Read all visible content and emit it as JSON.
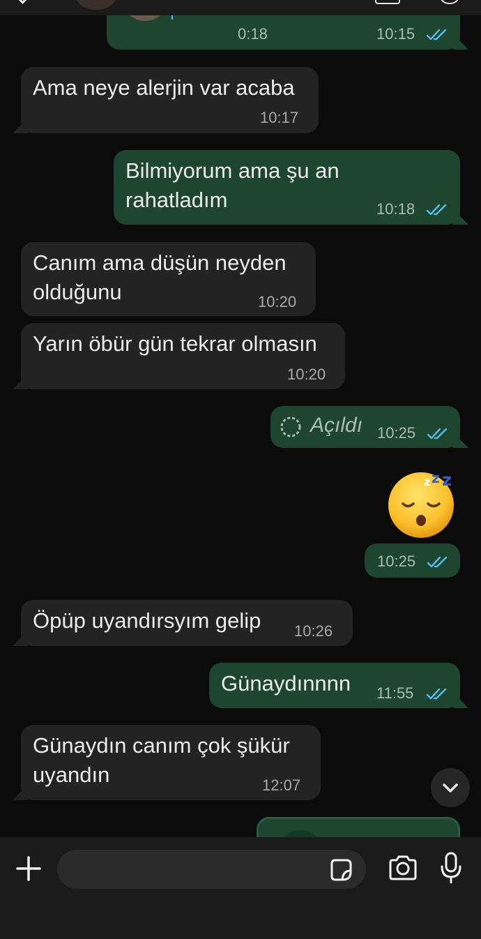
{
  "voice_message": {
    "duration": "0:18",
    "time": "10:15"
  },
  "messages": [
    {
      "text": "Ama neye alerjin var acaba",
      "time": "10:17"
    },
    {
      "text": "Bilmiyorum ama şu an\nrahatladım",
      "time": "10:18"
    },
    {
      "text": "Canım ama düşün neyden\nolduğunu",
      "time": "10:20"
    },
    {
      "text": "Yarın öbür gün tekrar olmasın",
      "time": "10:20"
    },
    {
      "text": "Açıldı",
      "time": "10:25"
    },
    {
      "text": "",
      "time": "10:25"
    },
    {
      "text": "Öpüp uyandırsyım gelip",
      "time": "10:26"
    },
    {
      "text": "Günaydınnnn",
      "time": "11:55"
    },
    {
      "text": "Günaydın canım çok şükür\nuyandın",
      "time": "12:07"
    }
  ],
  "emoji": {
    "name": "sleeping-face"
  },
  "composer": {
    "placeholder": "",
    "value": ""
  },
  "colors": {
    "background": "#0b0b0b",
    "incoming_bubble": "#232323",
    "outgoing_bubble": "#1d4530",
    "read_ticks": "#53bdeb"
  }
}
